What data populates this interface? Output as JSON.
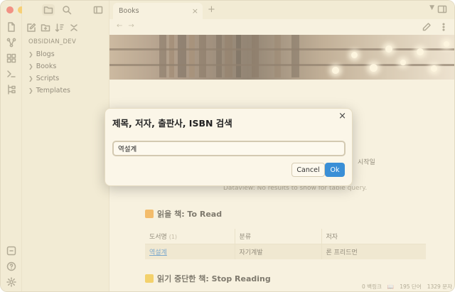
{
  "sidebar": {
    "vault_name": "OBSIDIAN_DEV",
    "folders": [
      {
        "label": "Blogs"
      },
      {
        "label": "Books"
      },
      {
        "label": "Scripts"
      },
      {
        "label": "Templates"
      }
    ]
  },
  "tabs": {
    "active_label": "Books",
    "close_glyph": "×",
    "new_tab_glyph": "+",
    "dropdown_glyph": "⌄"
  },
  "nav": {
    "back_glyph": "←",
    "forward_glyph": "→"
  },
  "content": {
    "hidden_column_header": "시작일",
    "dataview_empty": "Dataview: No results to show for table query.",
    "to_read_heading": "읽을 책: To Read",
    "stop_reading_heading": "읽기 중단한 책: Stop Reading",
    "table": {
      "headers": [
        "도서명",
        "분류",
        "저자"
      ],
      "header_count": "(1)",
      "rows": [
        {
          "title": "역설계",
          "category": "자기계발",
          "author": "론 프리드먼"
        }
      ]
    }
  },
  "status_bar": {
    "backlinks": "0 백링크",
    "words": "195 단어",
    "chars": "1329 문자"
  },
  "modal": {
    "title": "제목, 저자, 출판사, ISBN 검색",
    "close_glyph": "×",
    "input_value": "역설계",
    "cancel_label": "Cancel",
    "ok_label": "Ok"
  },
  "colors": {
    "accent": "#3a8fd6",
    "to_read_icon": "#f0a030",
    "stop_reading_icon": "#f0c030"
  },
  "icons": {
    "ribbon_top": [
      "files-icon",
      "graph-icon",
      "grid-icon",
      "terminal-icon",
      "tree-icon"
    ],
    "ribbon_bottom": [
      "vault-switch-icon",
      "help-icon",
      "settings-icon"
    ]
  }
}
